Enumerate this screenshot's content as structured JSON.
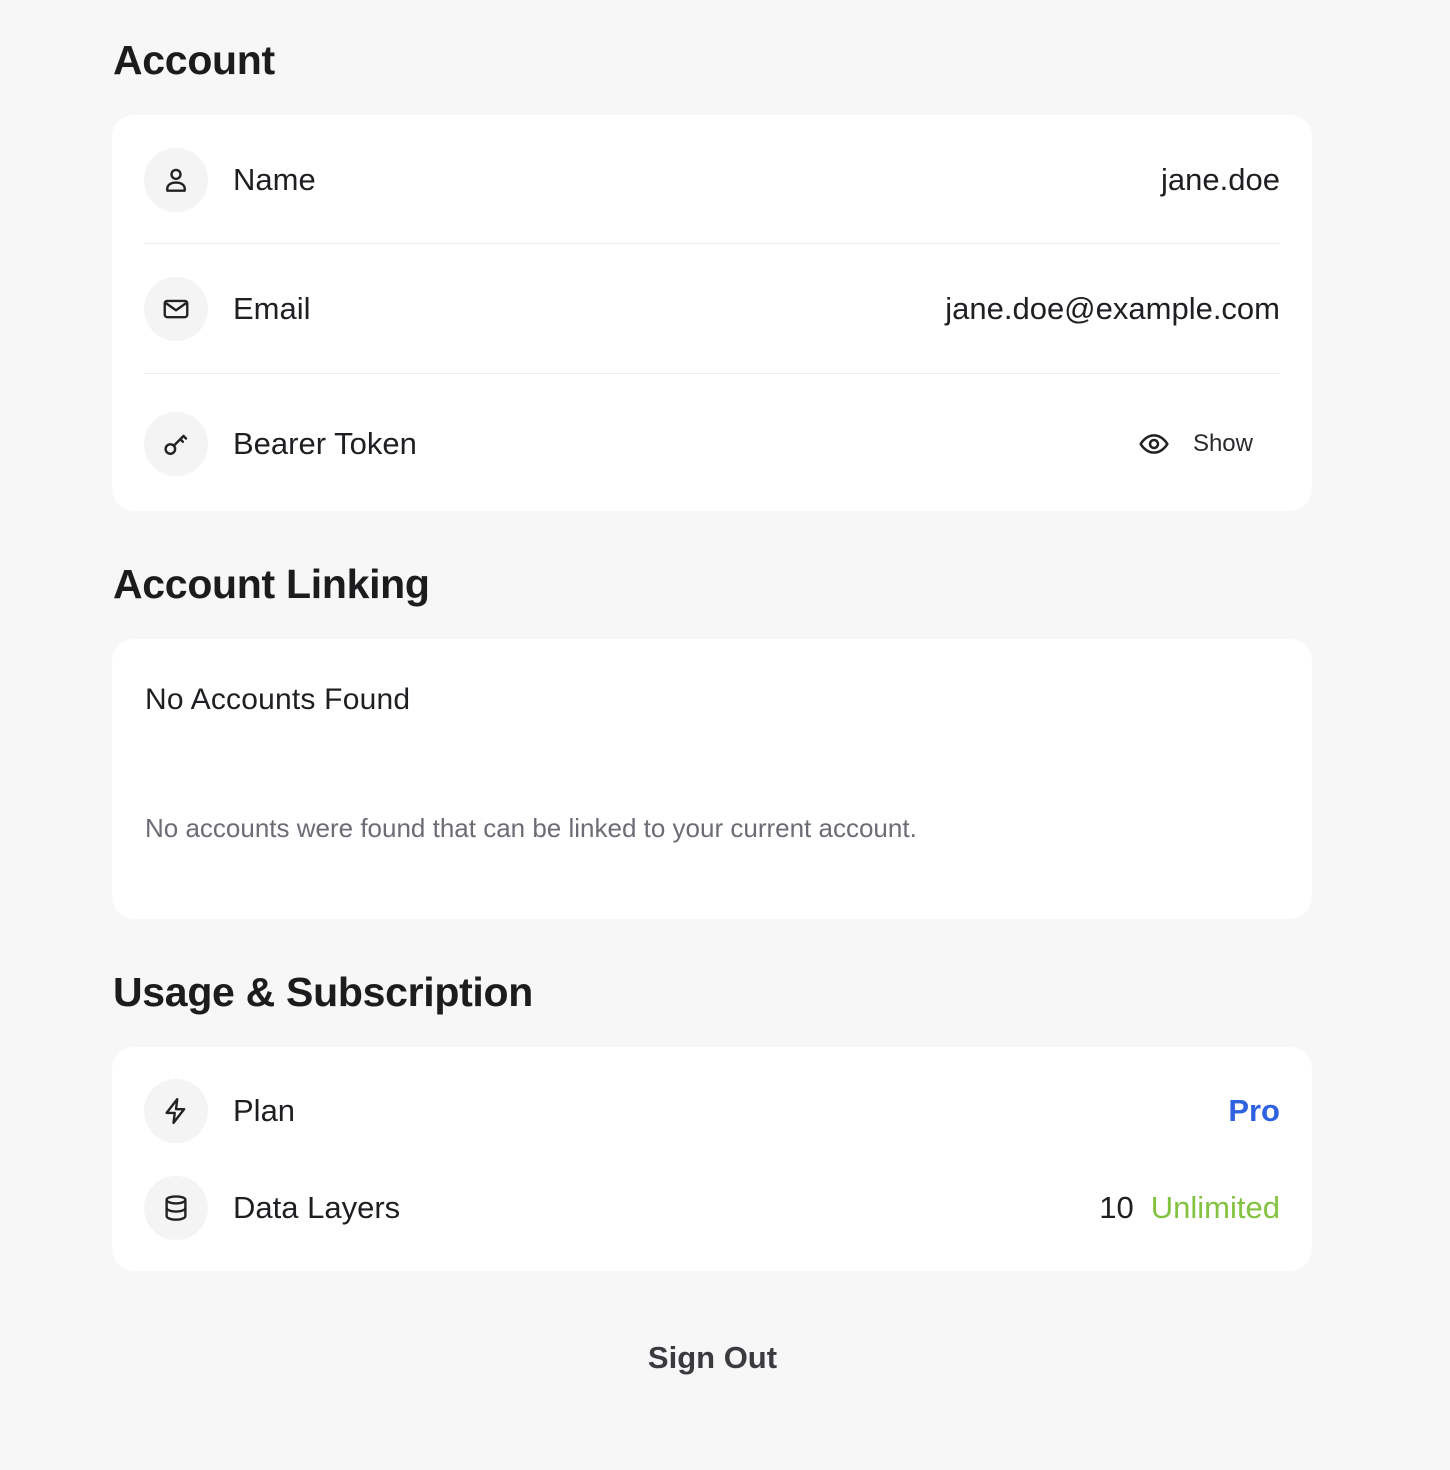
{
  "account": {
    "title": "Account",
    "name": {
      "label": "Name",
      "value": "jane.doe",
      "icon": "user-icon"
    },
    "email": {
      "label": "Email",
      "value": "jane.doe@example.com",
      "icon": "mail-icon"
    },
    "token": {
      "label": "Bearer Token",
      "show_label": "Show",
      "icon": "key-icon",
      "show_icon": "eye-icon"
    }
  },
  "account_linking": {
    "title": "Account Linking",
    "empty_title": "No Accounts Found",
    "empty_description": "No accounts were found that can be linked to your current account."
  },
  "usage": {
    "title": "Usage & Subscription",
    "plan": {
      "label": "Plan",
      "value": "Pro",
      "icon": "lightning-icon",
      "color": "#2f62e0"
    },
    "data_layers": {
      "label": "Data Layers",
      "count": "10",
      "limit": "Unlimited",
      "icon": "database-icon",
      "limit_color": "#84c341"
    }
  },
  "sign_out_label": "Sign Out",
  "colors": {
    "background": "#f7f7f7",
    "card": "#ffffff",
    "accent_blue": "#2f62e0",
    "accent_green": "#84c341"
  }
}
